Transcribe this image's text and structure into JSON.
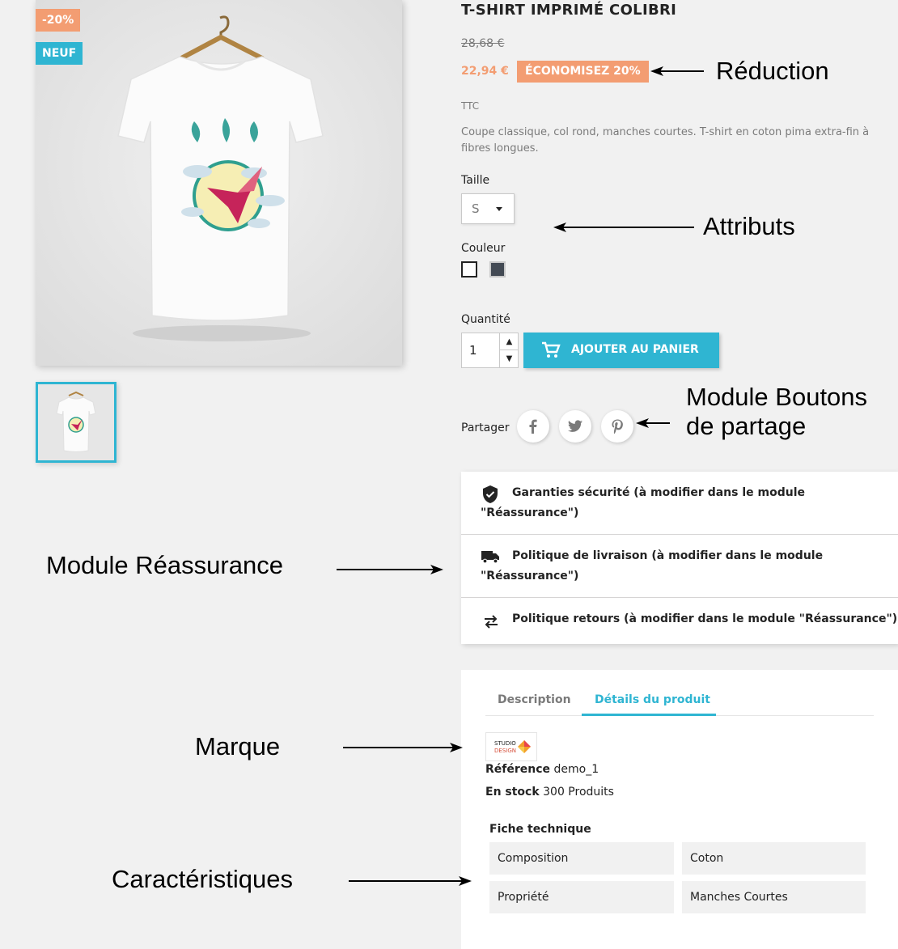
{
  "product": {
    "title": "T-SHIRT IMPRIMÉ COLIBRI",
    "badge_discount": "-20%",
    "badge_new": "NEUF",
    "old_price": "28,68 €",
    "price": "22,94 €",
    "save_label": "ÉCONOMISEZ 20%",
    "tax_label": "TTC",
    "description": "Coupe classique, col rond, manches courtes. T-shirt en coton pima extra-fin à fibres longues."
  },
  "variants": {
    "size_label": "Taille",
    "size_value": "S",
    "color_label": "Couleur",
    "colors": [
      "#ffffff",
      "#434a54"
    ]
  },
  "cart": {
    "qty_label": "Quantité",
    "qty_value": "1",
    "add_to_cart": "AJOUTER AU PANIER"
  },
  "share": {
    "label": "Partager",
    "buttons": [
      "facebook-icon",
      "twitter-icon",
      "pinterest-icon"
    ]
  },
  "reassurance": {
    "items": [
      {
        "icon": "shield-check-icon",
        "text": "Garanties sécurité (à modifier dans le module \"Réassurance\")"
      },
      {
        "icon": "truck-icon",
        "text": "Politique de livraison (à modifier dans le module \"Réassurance\")"
      },
      {
        "icon": "swap-arrows-icon",
        "text": "Politique retours (à modifier dans le module \"Réassurance\")"
      }
    ]
  },
  "tabs": {
    "description": "Description",
    "details": "Détails du produit"
  },
  "details": {
    "brand_line1": "STUDIO",
    "brand_line2": "DESIGN",
    "reference_label": "Référence",
    "reference_value": "demo_1",
    "stock_label": "En stock",
    "stock_value": "300 Produits",
    "datasheet_title": "Fiche technique",
    "features": [
      {
        "name": "Composition",
        "value": "Coton"
      },
      {
        "name": "Propriété",
        "value": "Manches Courtes"
      }
    ]
  },
  "annotations": {
    "reduction": "Réduction",
    "attributs": "Attributs",
    "share_line1": "Module Boutons",
    "share_line2": "de partage",
    "reassurance": "Module Réassurance",
    "marque": "Marque",
    "caracteristiques": "Caractéristiques"
  },
  "colors": {
    "accent": "#2fb5d2",
    "discount": "#f39d72",
    "background": "#f1f1f1"
  }
}
